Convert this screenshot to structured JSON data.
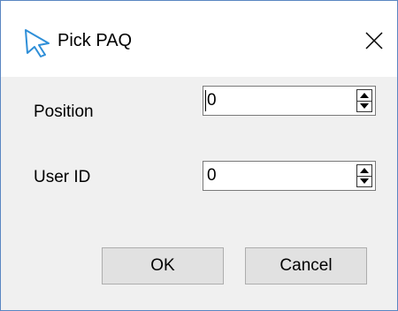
{
  "window": {
    "title": "Pick PAQ",
    "icon": "cursor-arrow-icon",
    "close_icon": "close-icon",
    "accent_color": "#5a86c2"
  },
  "fields": [
    {
      "label": "Position",
      "value": "0"
    },
    {
      "label": "User ID",
      "value": "0"
    }
  ],
  "buttons": {
    "ok_label": "OK",
    "cancel_label": "Cancel"
  }
}
